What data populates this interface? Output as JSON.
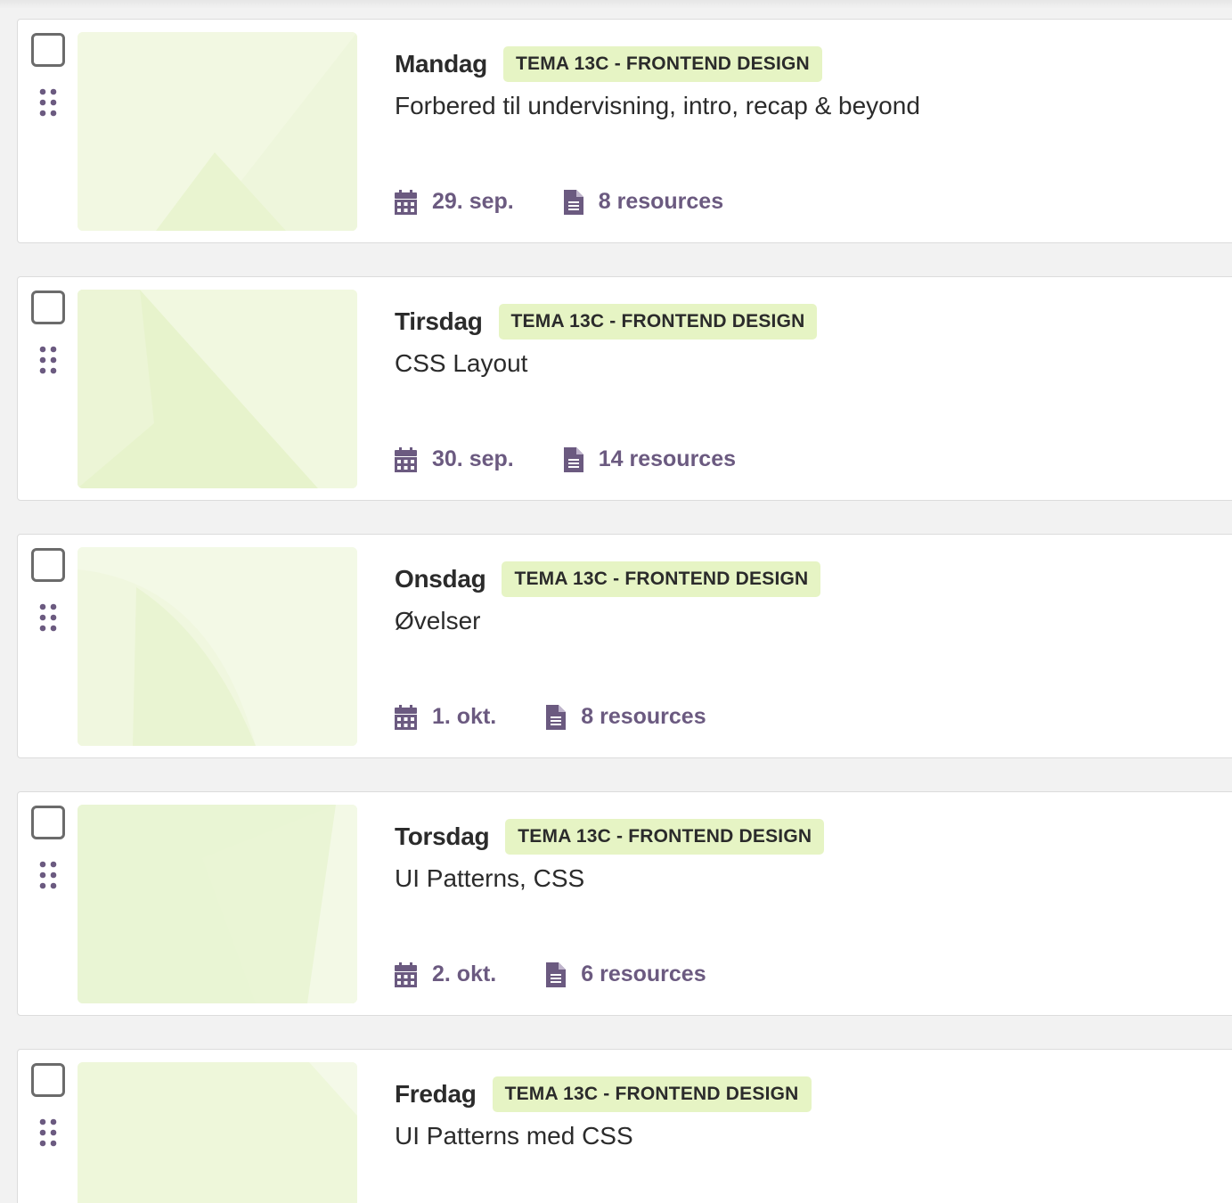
{
  "colors": {
    "accent": "#6b5a80",
    "tag_background": "#e6f4c4",
    "thumbnail_background": "#f0f7dc",
    "card_background": "#ffffff",
    "page_background": "#f2f2f2"
  },
  "lessons": [
    {
      "day": "Mandag",
      "tag": "TEMA 13C - FRONTEND DESIGN",
      "title": "Forbered til undervisning, intro, recap & beyond",
      "date": "29. sep.",
      "resources": "8 resources"
    },
    {
      "day": "Tirsdag",
      "tag": "TEMA 13C - FRONTEND DESIGN",
      "title": "CSS Layout",
      "date": "30. sep.",
      "resources": "14 resources"
    },
    {
      "day": "Onsdag",
      "tag": "TEMA 13C - FRONTEND DESIGN",
      "title": "Øvelser",
      "date": "1. okt.",
      "resources": "8 resources"
    },
    {
      "day": "Torsdag",
      "tag": "TEMA 13C - FRONTEND DESIGN",
      "title": "UI Patterns, CSS",
      "date": "2. okt.",
      "resources": "6 resources"
    },
    {
      "day": "Fredag",
      "tag": "TEMA 13C - FRONTEND DESIGN",
      "title": "UI Patterns med CSS",
      "date": "",
      "resources": ""
    }
  ]
}
